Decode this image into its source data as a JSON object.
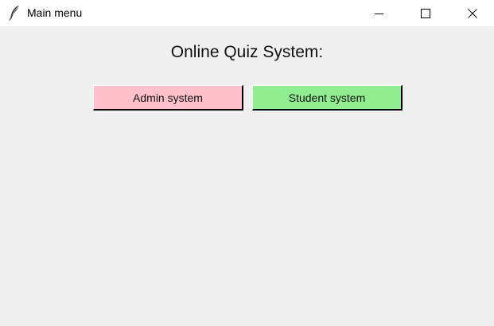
{
  "window": {
    "title": "Main menu",
    "app_icon": "feather-icon",
    "controls": {
      "minimize_icon": "minimize-icon",
      "maximize_icon": "maximize-icon",
      "close_icon": "close-icon"
    }
  },
  "main": {
    "heading": "Online Quiz System:",
    "buttons": [
      {
        "label": "Admin system",
        "color": "#ffc0cb"
      },
      {
        "label": "Student system",
        "color": "#90ee90"
      }
    ]
  },
  "colors": {
    "background": "#f0f0f0",
    "titlebar": "#ffffff"
  }
}
